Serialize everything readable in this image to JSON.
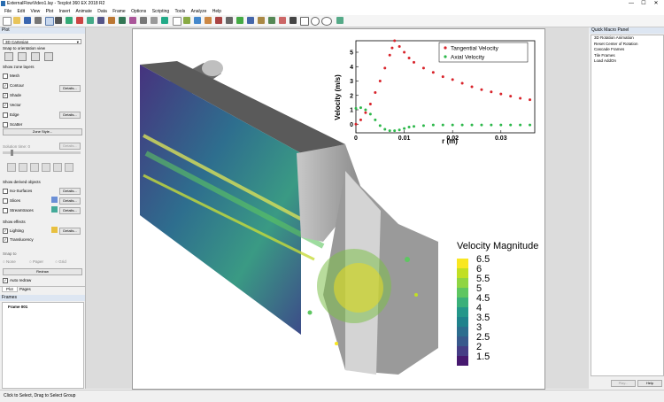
{
  "window": {
    "title": "ExternalFlowVideo1.lay - Tecplot 360 EX 2018 R2",
    "min": "—",
    "max": "☐",
    "close": "✕"
  },
  "menu": [
    "File",
    "Edit",
    "View",
    "Plot",
    "Insert",
    "Animate",
    "Data",
    "Frame",
    "Options",
    "Scripting",
    "Tools",
    "Analyze",
    "Help"
  ],
  "sidebar": {
    "title": "Plot",
    "plot_type": "3D Cartesian",
    "snap_label": "Snap to orientation view",
    "zone_layers_label": "Show zone layers",
    "layers": [
      {
        "label": "Mesh",
        "checked": false
      },
      {
        "label": "Contour",
        "checked": true,
        "details": "Details..."
      },
      {
        "label": "Shade",
        "checked": true
      },
      {
        "label": "Vector",
        "checked": true
      },
      {
        "label": "Edge",
        "checked": false,
        "details": "Details..."
      },
      {
        "label": "Scatter",
        "checked": false
      }
    ],
    "zone_style": "Zone Style...",
    "solution_time": "Solution time:  0",
    "details": "Details...",
    "derived_label": "Show derived objects",
    "derived": [
      {
        "label": "Iso-Surfaces",
        "details": "Details..."
      },
      {
        "label": "Slices",
        "details": "Details..."
      },
      {
        "label": "Streamtraces",
        "details": "Details..."
      }
    ],
    "effects_label": "Show effects",
    "effects": [
      {
        "label": "Lighting",
        "checked": true,
        "details": "Details..."
      },
      {
        "label": "Translucency",
        "checked": true
      }
    ],
    "snap_to": "Snap to",
    "snap_opts": [
      "None",
      "Paper",
      "Grid"
    ],
    "redraw": "Redraw",
    "auto_redraw": "Auto redraw",
    "tabs": [
      "Plot",
      "Pages"
    ],
    "frames_title": "Frames",
    "frame_item": "Frame 001"
  },
  "quick_macro": {
    "title": "Quick Macro Panel",
    "items": [
      "3D Rotation Animation",
      "Reset Center of Rotation",
      "Cascade Frames",
      "Tile Frames",
      "Load AddOn"
    ],
    "play": "Play...",
    "help": "Help"
  },
  "status": "Click to Select, Drag to Select Group",
  "inset_chart": {
    "ylabel": "Velocity (m/s)",
    "xlabel": "r (m)",
    "yticks": [
      "0",
      "1",
      "2",
      "3",
      "4",
      "5"
    ],
    "xticks": [
      "0",
      "0.01",
      "0.02",
      "0.03"
    ],
    "legend": [
      "Tangential Velocity",
      "Axial Velocity"
    ],
    "colors": {
      "tangential": "#d8232a",
      "axial": "#2db84b"
    }
  },
  "chart_data": {
    "type": "scatter",
    "xlabel": "r (m)",
    "ylabel": "Velocity (m/s)",
    "xlim": [
      0,
      0.037
    ],
    "ylim": [
      -0.6,
      5.8
    ],
    "series": [
      {
        "name": "Tangential Velocity",
        "x": [
          0.0,
          0.001,
          0.002,
          0.003,
          0.004,
          0.005,
          0.006,
          0.007,
          0.0075,
          0.008,
          0.009,
          0.01,
          0.011,
          0.012,
          0.014,
          0.016,
          0.018,
          0.02,
          0.022,
          0.024,
          0.026,
          0.028,
          0.03,
          0.032,
          0.034,
          0.036
        ],
        "y": [
          0.0,
          0.3,
          0.8,
          1.4,
          2.2,
          3.0,
          3.9,
          4.8,
          5.3,
          5.8,
          5.4,
          5.0,
          4.6,
          4.3,
          3.9,
          3.6,
          3.3,
          3.1,
          2.85,
          2.6,
          2.4,
          2.25,
          2.1,
          1.95,
          1.8,
          1.7
        ]
      },
      {
        "name": "Axial Velocity",
        "x": [
          0.0,
          0.001,
          0.002,
          0.003,
          0.004,
          0.005,
          0.006,
          0.007,
          0.008,
          0.009,
          0.01,
          0.011,
          0.012,
          0.014,
          0.016,
          0.018,
          0.02,
          0.022,
          0.024,
          0.026,
          0.028,
          0.03,
          0.032,
          0.034,
          0.036
        ],
        "y": [
          1.1,
          1.15,
          1.0,
          0.7,
          0.3,
          -0.1,
          -0.35,
          -0.45,
          -0.45,
          -0.4,
          -0.3,
          -0.2,
          -0.15,
          -0.1,
          -0.05,
          -0.05,
          -0.05,
          -0.05,
          -0.05,
          -0.05,
          -0.05,
          -0.05,
          -0.05,
          -0.05,
          -0.05
        ]
      }
    ]
  },
  "colorbar": {
    "title": "Velocity Magnitude",
    "levels": [
      "6.5",
      "6",
      "5.5",
      "5",
      "4.5",
      "4",
      "3.5",
      "3",
      "2.5",
      "2",
      "1.5"
    ],
    "colors": [
      "#f9e721",
      "#c1df24",
      "#8fd543",
      "#5ec661",
      "#3ab07a",
      "#24978a",
      "#1f828c",
      "#2c6d8e",
      "#38598c",
      "#453d85",
      "#46186f"
    ]
  }
}
